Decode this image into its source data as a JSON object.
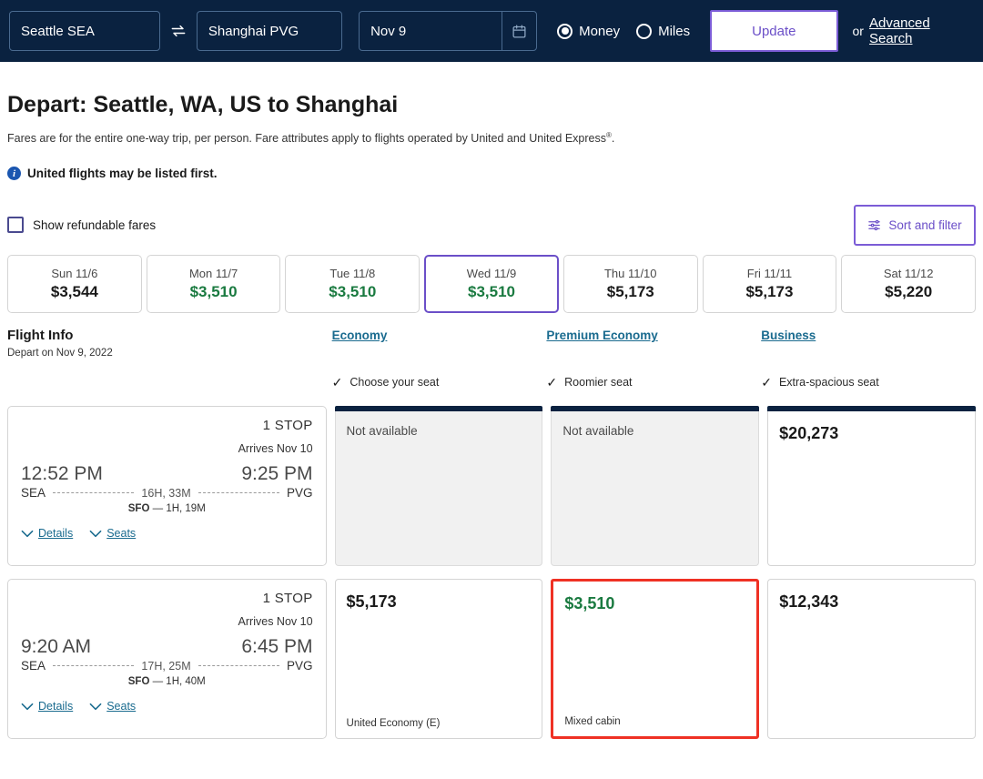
{
  "search": {
    "origin": "Seattle SEA",
    "destination": "Shanghai PVG",
    "date": "Nov 9",
    "swap_icon": "swap-arrows-icon",
    "calendar_icon": "calendar-icon",
    "fare_types": [
      {
        "label": "Money",
        "selected": true
      },
      {
        "label": "Miles",
        "selected": false
      }
    ],
    "update_label": "Update",
    "or_label": "or",
    "advanced_search_label": "Advanced Search"
  },
  "header": {
    "title": "Depart: Seattle, WA, US to Shanghai",
    "fare_note": "Fares are for the entire one-way trip, per person. Fare attributes apply to flights operated by United and United Express",
    "fare_note_sup": "®",
    "fare_note_end": ".",
    "info_icon": "info-icon",
    "info_text": "United flights may be listed first."
  },
  "filters": {
    "refundable_label": "Show refundable fares",
    "refundable_checked": false,
    "sort_filter_label": "Sort and filter",
    "sort_filter_icon": "sliders-icon"
  },
  "dates": [
    {
      "day": "Sun 11/6",
      "price": "$3,544",
      "green": false,
      "selected": false
    },
    {
      "day": "Mon 11/7",
      "price": "$3,510",
      "green": true,
      "selected": false
    },
    {
      "day": "Tue 11/8",
      "price": "$3,510",
      "green": true,
      "selected": false
    },
    {
      "day": "Wed 11/9",
      "price": "$3,510",
      "green": true,
      "selected": true
    },
    {
      "day": "Thu 11/10",
      "price": "$5,173",
      "green": false,
      "selected": false
    },
    {
      "day": "Fri 11/11",
      "price": "$5,173",
      "green": false,
      "selected": false
    },
    {
      "day": "Sat 11/12",
      "price": "$5,220",
      "green": false,
      "selected": false
    }
  ],
  "table_header": {
    "flight_info_title": "Flight Info",
    "flight_info_sub": "Depart on Nov 9, 2022",
    "cabins": [
      {
        "label": "Economy",
        "perk": "Choose your seat"
      },
      {
        "label": "Premium Economy",
        "perk": "Roomier seat"
      },
      {
        "label": "Business",
        "perk": "Extra-spacious seat"
      }
    ]
  },
  "flights": [
    {
      "stops": "1 STOP",
      "arrives": "Arrives Nov 10",
      "depart_time": "12:52 PM",
      "arrive_time": "9:25 PM",
      "origin_code": "SEA",
      "dest_code": "PVG",
      "duration": "16H, 33M",
      "connection_code": "SFO",
      "connection_sep": "—",
      "connection_duration": "1H, 19M",
      "details_label": "Details",
      "seats_label": "Seats",
      "fares": [
        {
          "price": "Not available",
          "available": false,
          "green": false,
          "meta": "",
          "topbar": true,
          "highlighted": false
        },
        {
          "price": "Not available",
          "available": false,
          "green": false,
          "meta": "",
          "topbar": true,
          "highlighted": false
        },
        {
          "price": "$20,273",
          "available": true,
          "green": false,
          "meta": "",
          "topbar": true,
          "highlighted": false
        }
      ]
    },
    {
      "stops": "1 STOP",
      "arrives": "Arrives Nov 10",
      "depart_time": "9:20 AM",
      "arrive_time": "6:45 PM",
      "origin_code": "SEA",
      "dest_code": "PVG",
      "duration": "17H, 25M",
      "connection_code": "SFO",
      "connection_sep": "—",
      "connection_duration": "1H, 40M",
      "details_label": "Details",
      "seats_label": "Seats",
      "fares": [
        {
          "price": "$5,173",
          "available": true,
          "green": false,
          "meta": "United Economy (E)",
          "topbar": false,
          "highlighted": false
        },
        {
          "price": "$3,510",
          "available": true,
          "green": true,
          "meta": "Mixed cabin",
          "topbar": false,
          "highlighted": true
        },
        {
          "price": "$12,343",
          "available": true,
          "green": false,
          "meta": "",
          "topbar": false,
          "highlighted": false
        }
      ]
    }
  ],
  "colors": {
    "navy": "#0a2240",
    "purple": "#6b4fc8",
    "green": "#1a7a40",
    "link_blue": "#1a6b8f",
    "highlight_red": "#ef3124"
  }
}
